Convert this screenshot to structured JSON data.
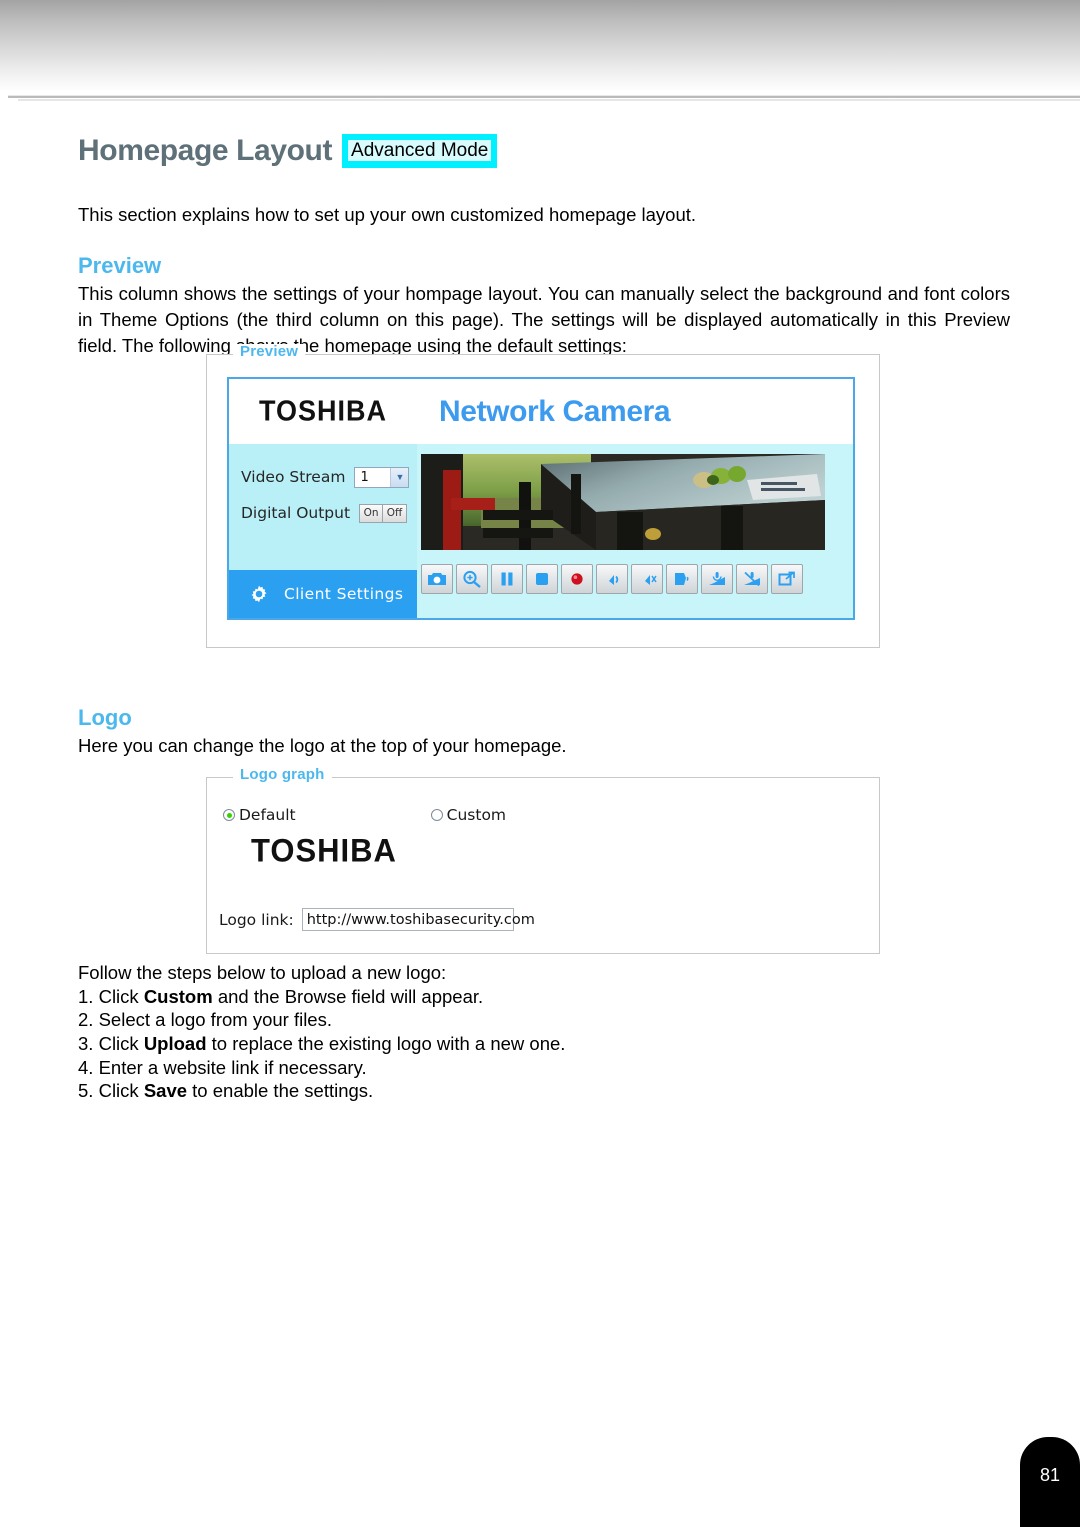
{
  "document": {
    "page_number": "81"
  },
  "title": {
    "heading": "Homepage Layout",
    "mode_badge": "Advanced Mode"
  },
  "intro": "This section explains how to set up your own customized homepage layout.",
  "preview_section": {
    "heading": "Preview",
    "paragraph": "This column shows the settings of your hompage layout. You can manually select the background and font colors in Theme Options (the third column on this page). The settings will be displayed automatically in this Preview field. The following shows the homepage using the default settings:",
    "fieldset_legend": "Preview",
    "camera_ui": {
      "logo_text": "TOSHIBA",
      "brand_title": "Network Camera",
      "video_stream_label": "Video Stream",
      "video_stream_value": "1",
      "digital_output_label": "Digital Output",
      "digital_output_on": "On",
      "digital_output_off": "Off",
      "client_settings_label": "Client Settings",
      "toolbar_icons": [
        "snapshot-camera-icon",
        "digital-zoom-icon",
        "pause-icon",
        "stop-icon",
        "record-icon",
        "volume-icon",
        "mute-icon",
        "talk-icon",
        "microphone-on-icon",
        "microphone-off-icon",
        "fullscreen-icon"
      ]
    }
  },
  "logo_section": {
    "heading": "Logo",
    "paragraph": "Here you can change the logo at the top of your homepage.",
    "fieldset_legend": "Logo graph",
    "radio_default": "Default",
    "radio_custom": "Custom",
    "logo_mark": "TOSHIBA",
    "logo_link_label": "Logo link:",
    "logo_link_value": "http://www.toshibasecurity.com",
    "steps_lead": "Follow the steps below to upload a new logo:",
    "steps": [
      {
        "num": "1. ",
        "pre": "Click ",
        "bold": "Custom",
        "post": " and the Browse field will appear."
      },
      {
        "num": "2. ",
        "pre": "Select a logo from your files.",
        "bold": "",
        "post": ""
      },
      {
        "num": "3. ",
        "pre": "Click ",
        "bold": "Upload",
        "post": " to replace the existing logo with a new one."
      },
      {
        "num": "4. ",
        "pre": "Enter a website link if necessary.",
        "bold": "",
        "post": ""
      },
      {
        "num": "5. ",
        "pre": "Click ",
        "bold": "Save",
        "post": " to enable the settings."
      }
    ]
  },
  "colors": {
    "heading_blue": "#4cb8ee",
    "title_gray": "#5e7078",
    "badge_cyan": "#00f0ff",
    "cam_border_blue": "#4aa8e8",
    "cam_panel_cyan": "#b9f0f7",
    "client_settings_blue": "#2ba0f0",
    "radio_green": "#35d400"
  }
}
